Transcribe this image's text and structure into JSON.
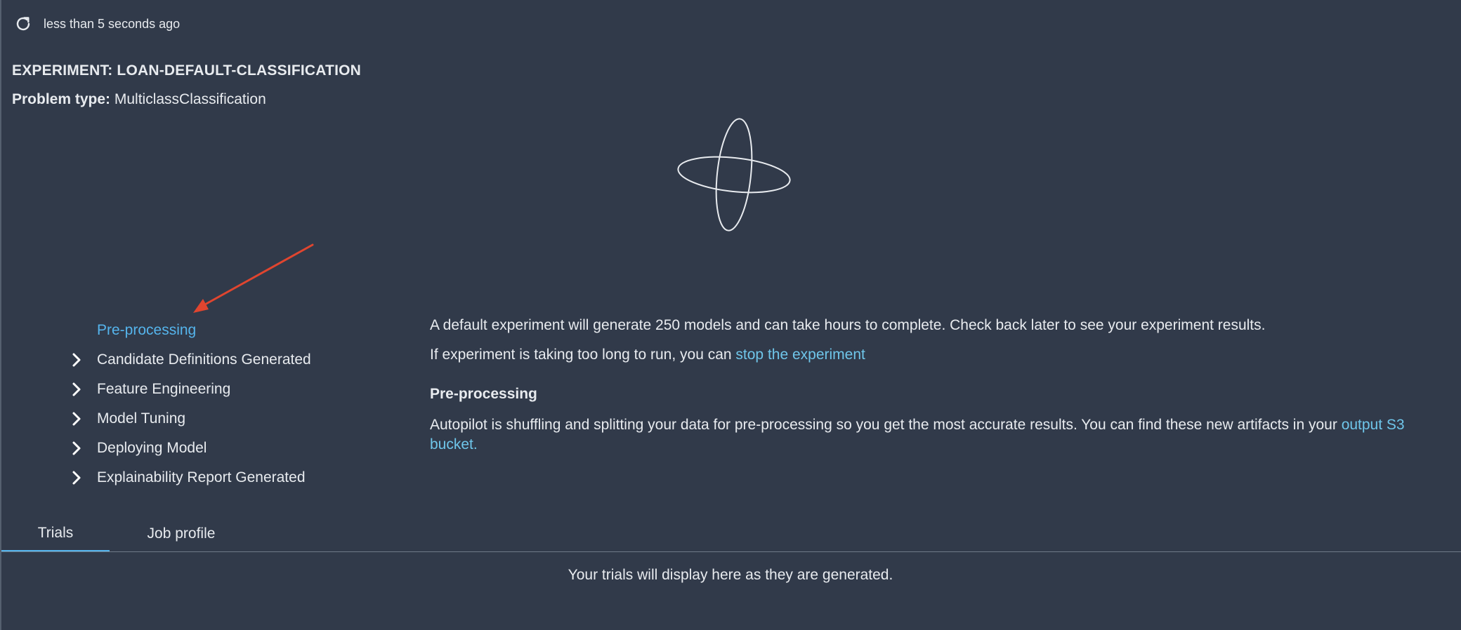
{
  "header": {
    "refresh_icon": "refresh-icon",
    "last_refreshed": "less than 5 seconds ago"
  },
  "experiment": {
    "title": "EXPERIMENT: LOAN-DEFAULT-CLASSIFICATION",
    "problem_type_label": "Problem type:",
    "problem_type_value": "MulticlassClassification"
  },
  "steps": [
    {
      "label": "Pre-processing",
      "active": true
    },
    {
      "label": "Candidate Definitions Generated",
      "active": false
    },
    {
      "label": "Feature Engineering",
      "active": false
    },
    {
      "label": "Model Tuning",
      "active": false
    },
    {
      "label": "Deploying Model",
      "active": false
    },
    {
      "label": "Explainability Report Generated",
      "active": false
    }
  ],
  "info": {
    "line1": "A default experiment will generate 250 models and can take hours to complete. Check back later to see your experiment results.",
    "line2_prefix": "If experiment is taking too long to run, you can ",
    "stop_link": "stop the experiment",
    "step_heading": "Pre-processing",
    "step_desc": "Autopilot is shuffling and splitting your data for pre-processing so you get the most accurate results. You can find these new artifacts in your ",
    "s3_link": "output S3 bucket."
  },
  "tabs": [
    {
      "label": "Trials",
      "selected": true
    },
    {
      "label": "Job profile",
      "selected": false
    }
  ],
  "trials_empty": "Your trials will display here as they are generated.",
  "colors": {
    "background": "#313a4a",
    "active_step": "#55b4ec",
    "link": "#6fc6ea",
    "annotation_arrow": "#e0452f"
  }
}
